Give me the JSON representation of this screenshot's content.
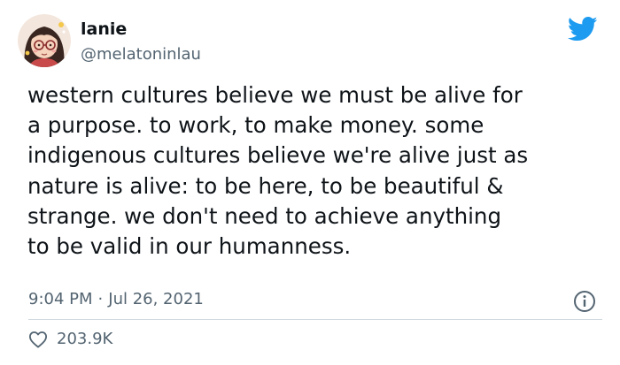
{
  "user": {
    "display_name": "lanie",
    "handle": "@melatoninlau"
  },
  "tweet": {
    "text": "western cultures believe we must be alive for\na purpose. to work, to make money. some\nindigenous cultures believe we're alive just as\nnature is alive: to be here, to be beautiful &\nstrange. we don't need to achieve anything\nto be valid in our humanness.",
    "time": "9:04 PM",
    "separator": "·",
    "date": "Jul 26, 2021",
    "likes": "203.9K"
  },
  "icons": {
    "brand": "twitter-bird-icon",
    "info": "info-icon",
    "like": "heart-icon"
  },
  "colors": {
    "brand": "#1d9bf0",
    "text": "#0f1419",
    "secondary": "#536471",
    "divider": "#cfd9de"
  }
}
